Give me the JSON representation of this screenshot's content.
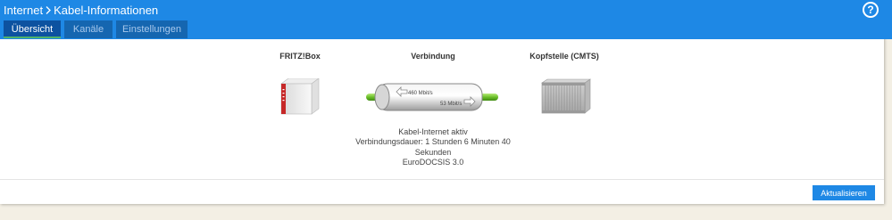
{
  "header": {
    "breadcrumb": [
      "Internet",
      "Kabel-Informationen"
    ],
    "help_icon": "help-circle-icon",
    "accent_color": "#1e88e5"
  },
  "tabs": [
    {
      "label": "Übersicht",
      "active": true
    },
    {
      "label": "Kanäle",
      "active": false
    },
    {
      "label": "Einstellungen",
      "active": false
    }
  ],
  "diagram": {
    "left_label": "FRITZ!Box",
    "center_label": "Verbindung",
    "right_label": "Kopfstelle (CMTS)",
    "downstream": "460 Mbit/s",
    "upstream": "53 Mbit/s"
  },
  "status": {
    "line1": "Kabel-Internet aktiv",
    "line2": "Verbindungsdauer: 1 Stunden 6 Minuten 40 Sekunden",
    "line3": "EuroDOCSIS 3.0"
  },
  "footer": {
    "refresh_label": "Aktualisieren"
  }
}
